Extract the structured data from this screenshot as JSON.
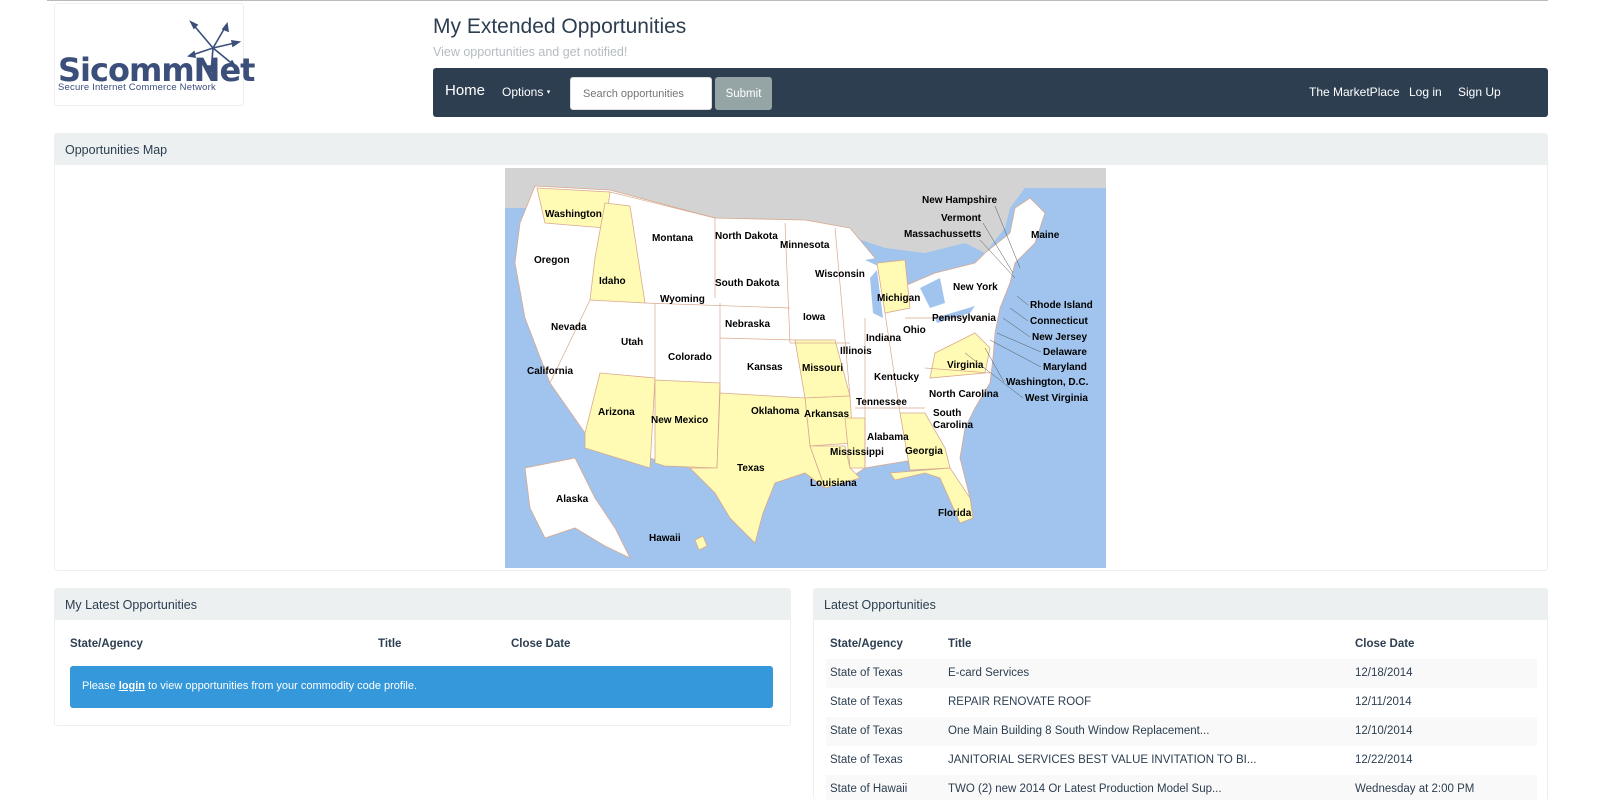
{
  "header": {
    "logo_text": "SicommNet",
    "logo_tagline": "Secure Internet Commerce Network",
    "title": "My Extended Opportunities",
    "subtitle": "View opportunities and get notified!"
  },
  "navbar": {
    "home": "Home",
    "options": "Options",
    "search_placeholder": "Search opportunities",
    "submit": "Submit",
    "marketplace": "The MarketPlace",
    "login": "Log in",
    "signup": "Sign Up"
  },
  "map_panel": {
    "title": "Opportunities Map",
    "highlighted_color": "#fffbb5",
    "states": [
      "Washington",
      "Oregon",
      "Idaho",
      "Montana",
      "North Dakota",
      "Minnesota",
      "South Dakota",
      "Wyoming",
      "Nevada",
      "Utah",
      "California",
      "Colorado",
      "Nebraska",
      "Kansas",
      "Iowa",
      "Wisconsin",
      "Michigan",
      "Illinois",
      "Indiana",
      "Ohio",
      "Missouri",
      "Oklahoma",
      "Arizona",
      "New Mexico",
      "Texas",
      "Arkansas",
      "Tennessee",
      "Kentucky",
      "Mississippi",
      "Alabama",
      "Georgia",
      "Louisiana",
      "Florida",
      "South",
      "Carolina",
      "North Carolina",
      "Virginia",
      "West Virginia",
      "Pennsylvania",
      "New York",
      "Maine",
      "New Hampshire",
      "Vermont",
      "Massachussetts",
      "Rhode Island",
      "Connecticut",
      "New Jersey",
      "Delaware",
      "Maryland",
      "Washington, D.C.",
      "Alaska",
      "Hawaii"
    ],
    "highlighted_states": [
      "Washington",
      "Idaho",
      "Michigan",
      "Missouri",
      "Arkansas",
      "Arizona",
      "New Mexico",
      "Texas",
      "Louisiana",
      "Mississippi",
      "Georgia",
      "Florida",
      "Virginia",
      "Hawaii"
    ]
  },
  "my_latest": {
    "title": "My Latest Opportunities",
    "columns": [
      "State/Agency",
      "Title",
      "Close Date"
    ],
    "alert_prefix": "Please ",
    "alert_link": "login",
    "alert_suffix": " to view opportunities from your commodity code profile."
  },
  "latest": {
    "title": "Latest Opportunities",
    "columns": [
      "State/Agency",
      "Title",
      "Close Date"
    ],
    "rows": [
      {
        "agency": "State of Texas",
        "title": "E-card Services",
        "close": "12/18/2014"
      },
      {
        "agency": "State of Texas",
        "title": "REPAIR RENOVATE ROOF",
        "close": "12/11/2014"
      },
      {
        "agency": "State of Texas",
        "title": "One Main Building 8 South Window Replacement...",
        "close": "12/10/2014"
      },
      {
        "agency": "State of Texas",
        "title": "JANITORIAL SERVICES BEST VALUE INVITATION TO BI...",
        "close": "12/22/2014"
      },
      {
        "agency": "State of Hawaii",
        "title": "TWO (2) new 2014 Or Latest Production Model Sup...",
        "close": "Wednesday at 2:00 PM"
      }
    ]
  }
}
